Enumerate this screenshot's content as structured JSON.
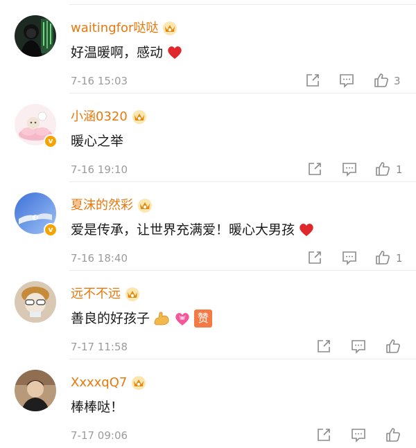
{
  "comments": [
    {
      "username": "waitingfor哒哒",
      "text": "好温暖啊，感动",
      "time": "7-16 15:03",
      "likes": "3",
      "verified": false,
      "emojis": [
        "red-heart"
      ]
    },
    {
      "username": "小涵0320",
      "text": "暖心之举",
      "time": "7-16 19:10",
      "likes": "1",
      "verified": true,
      "emojis": []
    },
    {
      "username": "夏沫的然彩",
      "text": "爱是传承，让世界充满爱！暖心大男孩",
      "time": "7-16 18:40",
      "likes": "1",
      "verified": true,
      "emojis": [
        "red-heart"
      ]
    },
    {
      "username": "远不不远",
      "text": "善良的好孩子",
      "time": "7-17 11:58",
      "likes": "",
      "verified": false,
      "emojis": [
        "flexed-biceps",
        "heart-with-ribbon",
        "zan-badge"
      ]
    },
    {
      "username": "XxxxqQ7",
      "text": "棒棒哒！",
      "time": "7-17 09:06",
      "likes": "",
      "verified": false,
      "emojis": []
    }
  ],
  "badges": {
    "verified_mark": "v",
    "zan_char": "赞"
  },
  "colors": {
    "username": "#e8780c",
    "time": "#9b9b9b",
    "text": "#1a1a1a",
    "icon": "#8a8a8a",
    "separator": "#ececec"
  },
  "icons": [
    "share-icon",
    "comment-icon",
    "like-icon",
    "vip-crown-icon"
  ]
}
